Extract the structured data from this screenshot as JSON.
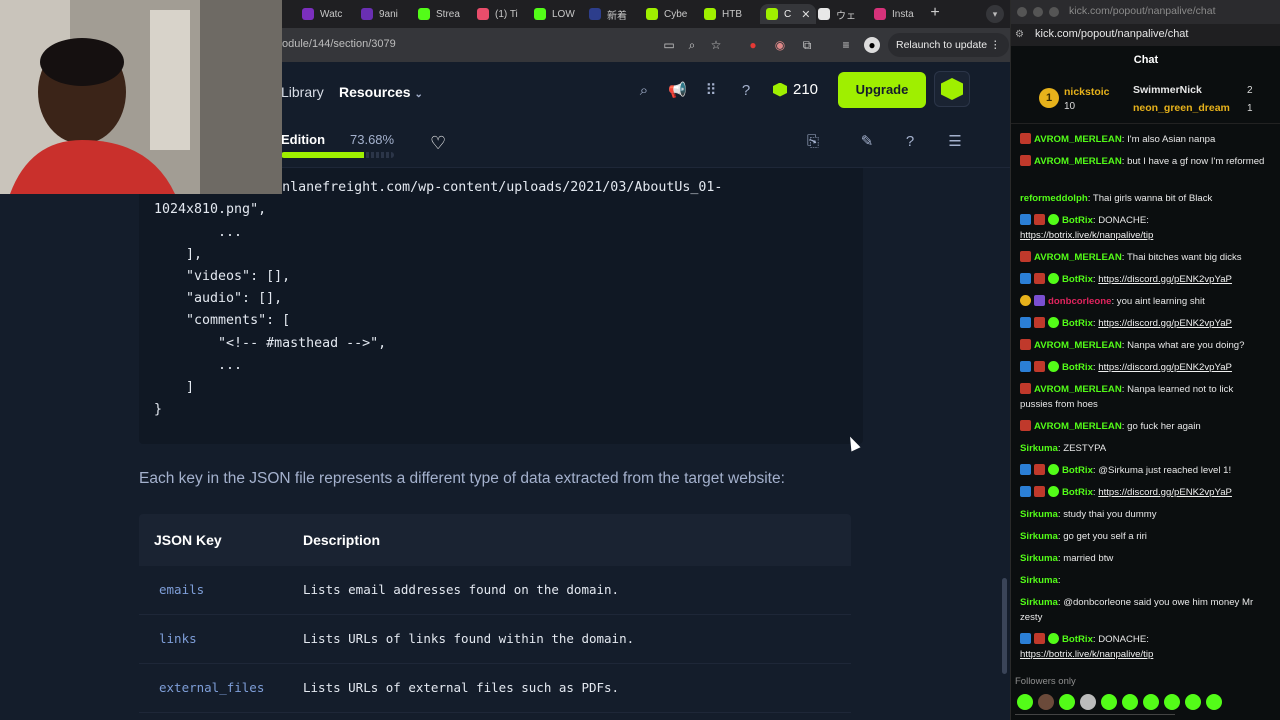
{
  "browser": {
    "tabs": [
      {
        "label": "Watc",
        "color": "#7b2fbe"
      },
      {
        "label": "9ani",
        "color": "#6a2fb3"
      },
      {
        "label": "Strea",
        "color": "#53fc18"
      },
      {
        "label": "(1) Ti",
        "color": "#e94d6b"
      },
      {
        "label": "LOW",
        "color": "#53fc18"
      },
      {
        "label": "新着",
        "color": "#2d3e8c"
      },
      {
        "label": "Cybe",
        "color": "#9fef00"
      },
      {
        "label": "HTB",
        "color": "#9fef00"
      },
      {
        "label": "C",
        "color": "#9fef00",
        "active": true
      },
      {
        "label": "ウェ",
        "color": "#e8e8e8"
      },
      {
        "label": "Insta",
        "color": "#d6327a"
      }
    ],
    "new_tab": "+",
    "url": "odule/144/section/3079",
    "relaunch_label": "Relaunch to update"
  },
  "site": {
    "nav": {
      "library": "Library",
      "resources": "Resources"
    },
    "cubes_count": "210",
    "upgrade_label": "Upgrade",
    "section": {
      "edition_label": "Edition",
      "progress_text": "73.68%",
      "progress_value": 0.7368
    }
  },
  "code": {
    "lines": [
      "  \"https://www.inlanefreight.com/wp-content/uploads/2021/03/AboutUs_01-",
      "1024x810.png\",",
      "        ...",
      "    ],",
      "    \"videos\": [],",
      "    \"audio\": [],",
      "    \"comments\": [",
      "        \"<!-- #masthead -->\",",
      "        ...",
      "    ]",
      "}"
    ]
  },
  "prose": "Each key in the JSON file represents a different type of data extracted from the target website:",
  "table": {
    "headers": [
      "JSON Key",
      "Description"
    ],
    "rows": [
      {
        "key": "emails",
        "desc": "Lists email addresses found on the domain."
      },
      {
        "key": "links",
        "desc": "Lists URLs of links found within the domain."
      },
      {
        "key": "external_files",
        "desc": "Lists URLs of external files such as PDFs."
      }
    ]
  },
  "chat": {
    "window_title": "kick.com/popout/nanpalive/chat",
    "bar_url": "kick.com/popout/nanpalive/chat",
    "title": "Chat",
    "leaderboard": {
      "rank": "1",
      "first": {
        "name": "nickstoic",
        "count": "10"
      },
      "second": {
        "name": "SwimmerNick",
        "count": "2"
      },
      "third": {
        "name": "neon_green_dream",
        "count": "1"
      }
    },
    "messages": [
      {
        "user": "AVROM_MERLEAN",
        "color": "#53fc18",
        "text": ": I'm also Asian nanpa"
      },
      {
        "user": "AVROM_MERLEAN",
        "color": "#53fc18",
        "text": ": but I have a gf now I'm reformed"
      },
      {
        "user": "reformeddolph",
        "color": "#53fc18",
        "text": ": Thai girls wanna bit of Black"
      },
      {
        "user": "BotRix",
        "color": "#53fc18",
        "text": ": DONACHE:",
        "link": "https://botrix.live/k/nanpalive/tip"
      },
      {
        "user": "AVROM_MERLEAN",
        "color": "#53fc18",
        "text": ": Thai bitches want big dicks"
      },
      {
        "user": "BotRix",
        "color": "#53fc18",
        "text": ": ",
        "link": "https://discord.gg/pENK2vpYaP"
      },
      {
        "user": "donbcorleone",
        "color": "#e0245e",
        "text": ": you aint learning shit"
      },
      {
        "user": "BotRix",
        "color": "#53fc18",
        "text": ": ",
        "link": "https://discord.gg/pENK2vpYaP"
      },
      {
        "user": "AVROM_MERLEAN",
        "color": "#53fc18",
        "text": ": Nanpa what are you doing?"
      },
      {
        "user": "BotRix",
        "color": "#53fc18",
        "text": ": ",
        "link": "https://discord.gg/pENK2vpYaP"
      },
      {
        "user": "AVROM_MERLEAN",
        "color": "#53fc18",
        "text": ": Nanpa learned not to lick pussies from hoes"
      },
      {
        "user": "AVROM_MERLEAN",
        "color": "#53fc18",
        "text": ": go fuck her again"
      },
      {
        "user": "Sirkuma",
        "color": "#53fc18",
        "text": ": ZESTYPA"
      },
      {
        "user": "BotRix",
        "color": "#53fc18",
        "text": ": @Sirkuma just reached level 1!"
      },
      {
        "user": "BotRix",
        "color": "#53fc18",
        "text": ": ",
        "link": "https://discord.gg/pENK2vpYaP"
      },
      {
        "user": "Sirkuma",
        "color": "#53fc18",
        "text": ": study thai you dummy"
      },
      {
        "user": "Sirkuma",
        "color": "#53fc18",
        "text": ": go get you self a riri"
      },
      {
        "user": "Sirkuma",
        "color": "#53fc18",
        "text": ": married btw"
      },
      {
        "user": "Sirkuma",
        "color": "#53fc18",
        "text": ":"
      },
      {
        "user": "Sirkuma",
        "color": "#53fc18",
        "text": ": @donbcorleone said you owe him money Mr zesty"
      },
      {
        "user": "BotRix",
        "color": "#53fc18",
        "text": ": DONACHE:",
        "link": "https://botrix.live/k/nanpalive/tip"
      }
    ],
    "followers_only": "Followers only"
  }
}
